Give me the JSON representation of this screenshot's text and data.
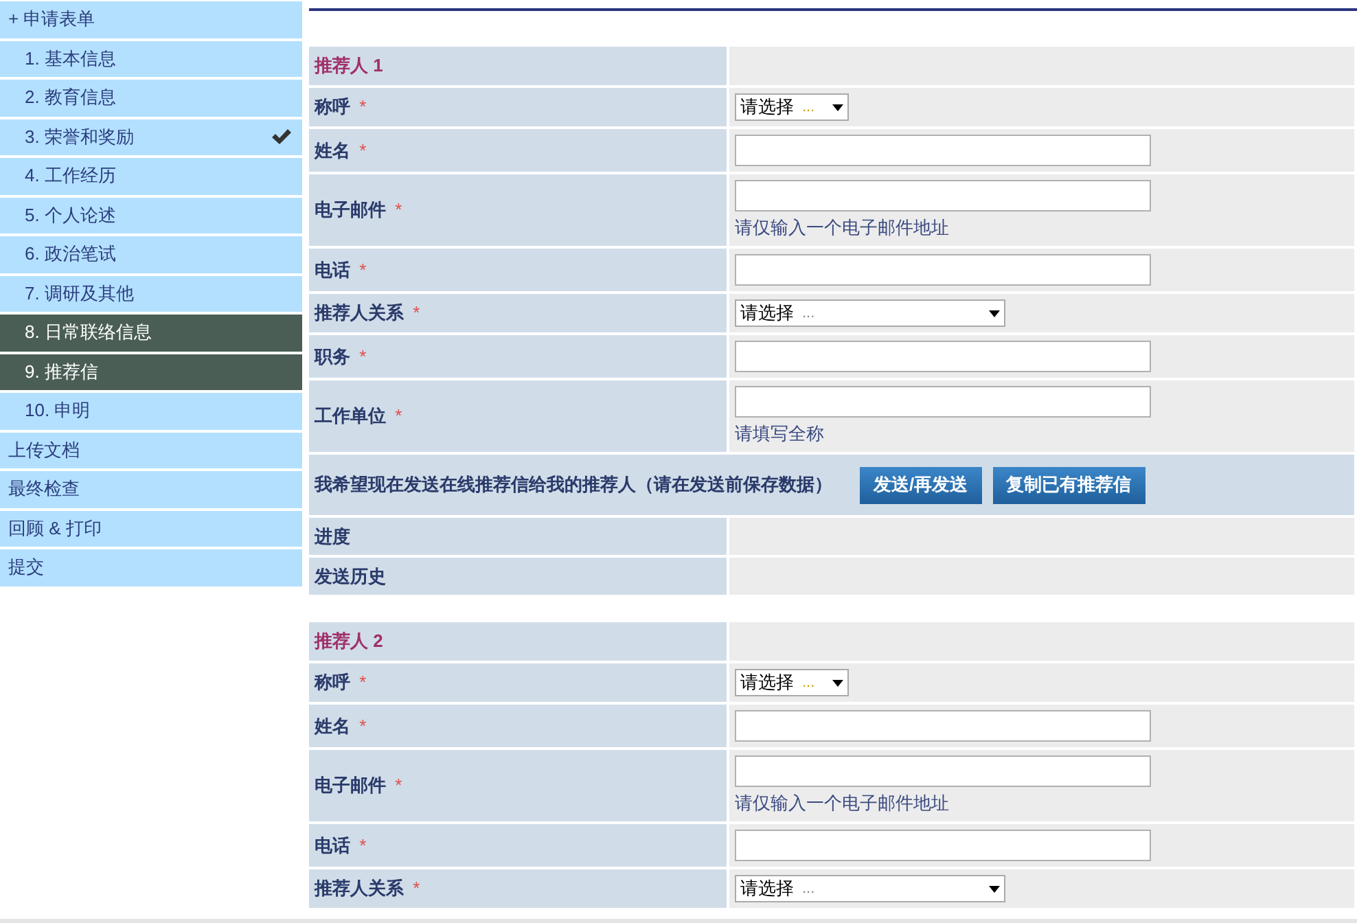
{
  "sidebar": {
    "items": [
      {
        "label": "+ 申请表单",
        "kind": "section",
        "selected": false,
        "completed": false
      },
      {
        "label": "1. 基本信息",
        "kind": "step",
        "selected": false,
        "completed": false
      },
      {
        "label": "2. 教育信息",
        "kind": "step",
        "selected": false,
        "completed": false
      },
      {
        "label": "3. 荣誉和奖励",
        "kind": "step",
        "selected": false,
        "completed": true
      },
      {
        "label": "4. 工作经历",
        "kind": "step",
        "selected": false,
        "completed": false
      },
      {
        "label": "5. 个人论述",
        "kind": "step",
        "selected": false,
        "completed": false
      },
      {
        "label": "6. 政治笔试",
        "kind": "step",
        "selected": false,
        "completed": false
      },
      {
        "label": "7. 调研及其他",
        "kind": "step",
        "selected": false,
        "completed": false
      },
      {
        "label": "8. 日常联络信息",
        "kind": "step",
        "selected": true,
        "completed": false
      },
      {
        "label": "9. 推荐信",
        "kind": "step",
        "selected": true,
        "completed": false
      },
      {
        "label": "10. 申明",
        "kind": "step",
        "selected": false,
        "completed": false
      },
      {
        "label": "上传文档",
        "kind": "section",
        "selected": false,
        "completed": false
      },
      {
        "label": "最终检查",
        "kind": "section",
        "selected": false,
        "completed": false
      },
      {
        "label": "回顾 & 打印",
        "kind": "section",
        "selected": false,
        "completed": false
      },
      {
        "label": "提交",
        "kind": "section",
        "selected": false,
        "completed": false
      }
    ]
  },
  "referees": [
    {
      "title": "推荐人 1",
      "rows": [
        {
          "kind": "select",
          "label": "称呼",
          "required": "*",
          "value": "请选择",
          "more": "..."
        },
        {
          "kind": "text",
          "label": "姓名",
          "required": "*"
        },
        {
          "kind": "text",
          "label": "电子邮件",
          "required": "*",
          "hint": "请仅输入一个电子邮件地址"
        },
        {
          "kind": "text",
          "label": "电话",
          "required": "*"
        },
        {
          "kind": "select-wide",
          "label": "推荐人关系",
          "required": "*",
          "value": "请选择",
          "more": "..."
        },
        {
          "kind": "text",
          "label": "职务",
          "required": "*"
        },
        {
          "kind": "text",
          "label": "工作单位",
          "required": "*",
          "hint": "请填写全称"
        },
        {
          "kind": "action",
          "label": "我希望现在发送在线推荐信给我的推荐人（请在发送前保存数据）",
          "buttons": [
            "发送/再发送",
            "复制已有推荐信"
          ]
        },
        {
          "kind": "info",
          "label": "进度"
        },
        {
          "kind": "info",
          "label": "发送历史"
        }
      ]
    },
    {
      "title": "推荐人 2",
      "rows": [
        {
          "kind": "select",
          "label": "称呼",
          "required": "*",
          "value": "请选择",
          "more": "..."
        },
        {
          "kind": "text",
          "label": "姓名",
          "required": "*"
        },
        {
          "kind": "text",
          "label": "电子邮件",
          "required": "*",
          "hint": "请仅输入一个电子邮件地址"
        },
        {
          "kind": "text",
          "label": "电话",
          "required": "*"
        },
        {
          "kind": "select-wide",
          "label": "推荐人关系",
          "required": "*",
          "value": "请选择",
          "more": "..."
        }
      ]
    }
  ]
}
